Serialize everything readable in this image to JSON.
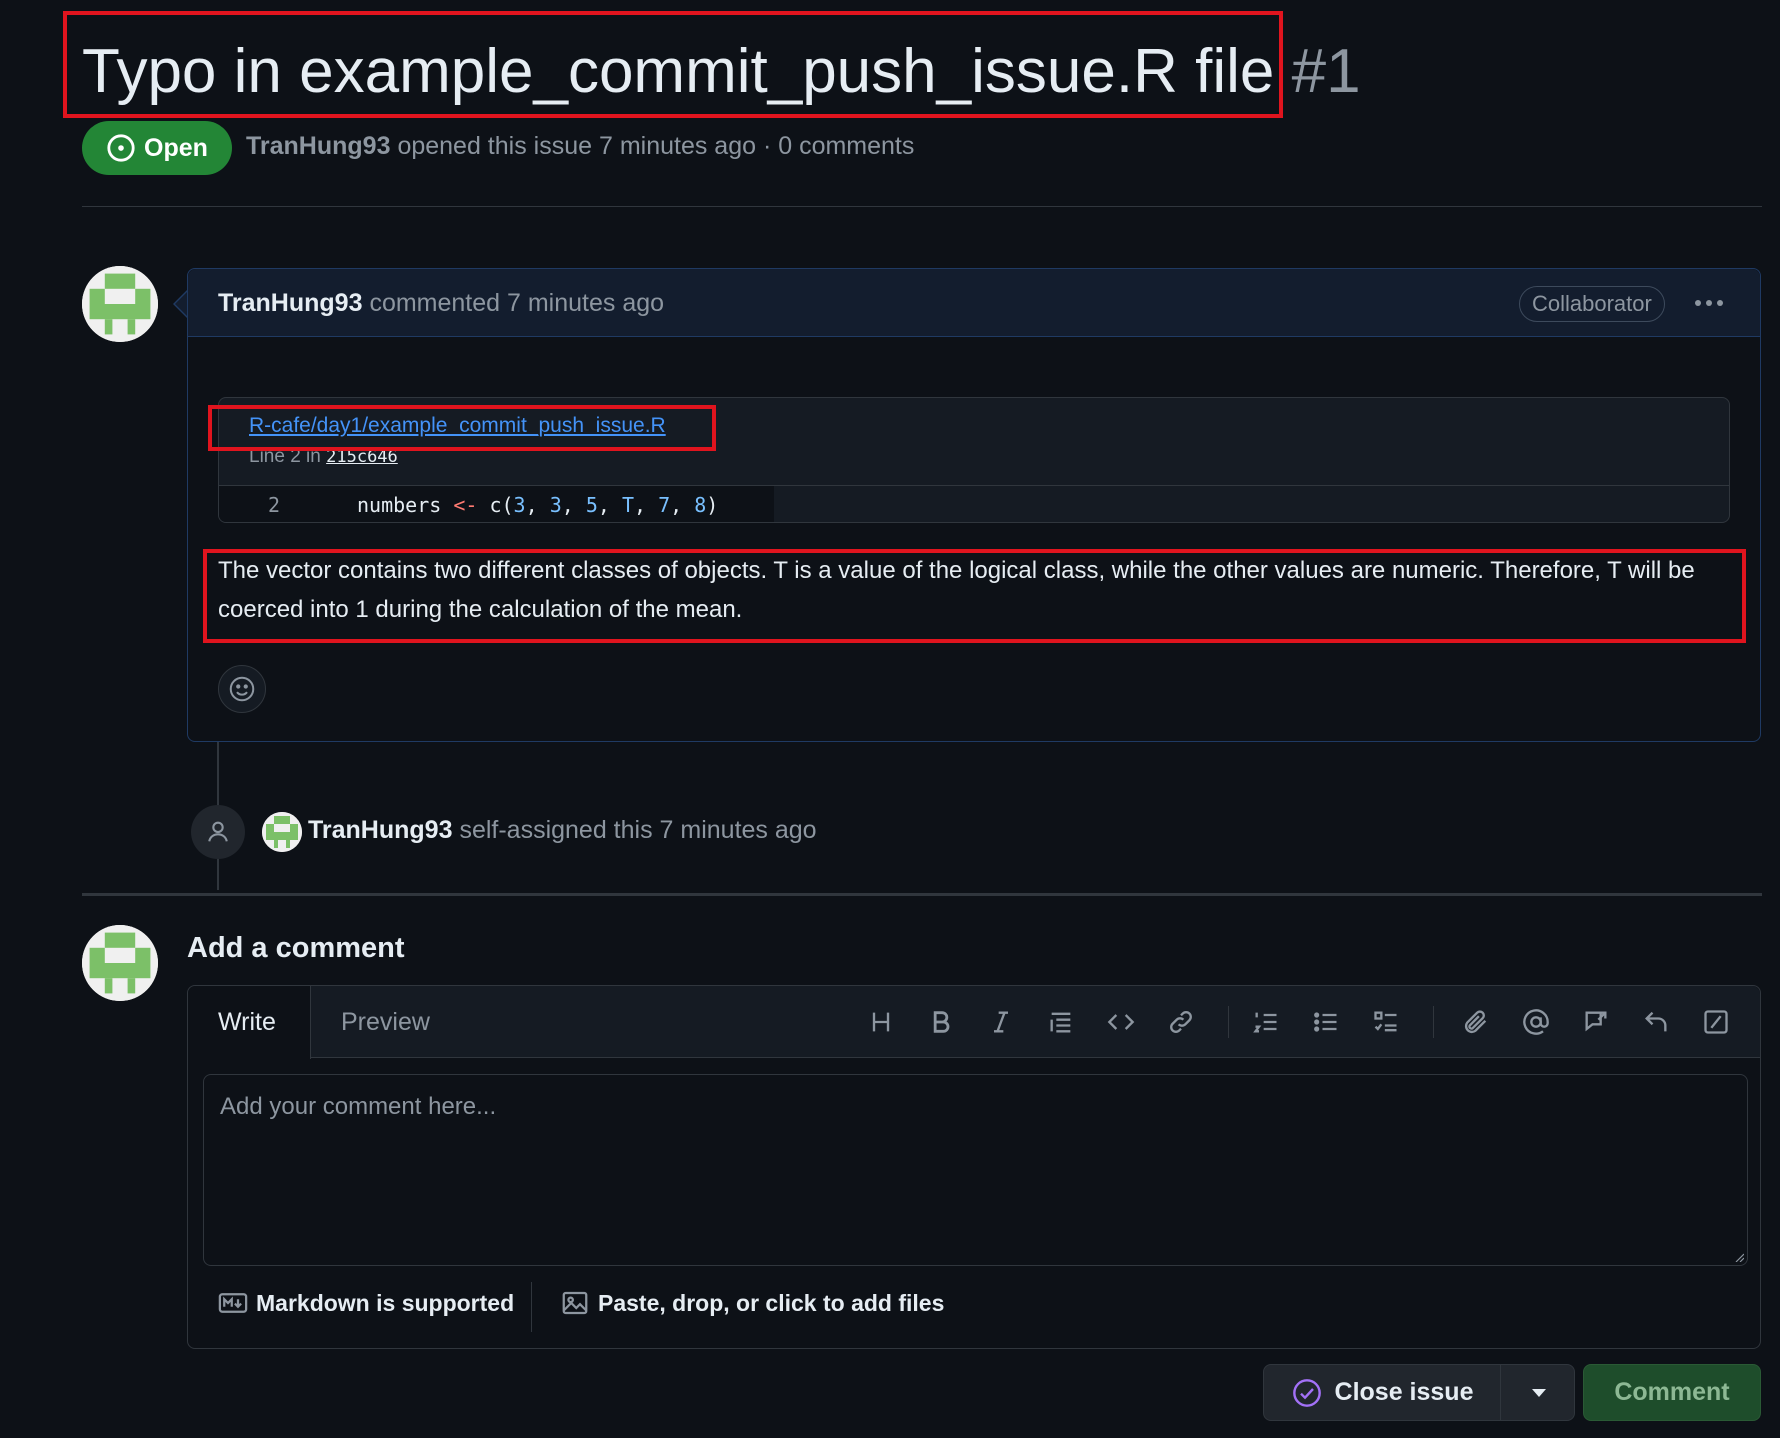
{
  "issue": {
    "title": "Typo in example_commit_push_issue.R file",
    "number": "#1",
    "state": "Open",
    "author": "TranHung93",
    "meta_text": "opened this issue 7 minutes ago · 0 comments"
  },
  "comment": {
    "author": "TranHung93",
    "meta_text": "commented 7 minutes ago",
    "role": "Collaborator",
    "snippet": {
      "file_path": "R-cafe/day1/example_commit_push_issue.R",
      "line_prefix": "Line 2 in",
      "commit_sha": "215c646",
      "line_number": "2",
      "code_tokens": {
        "var": "numbers ",
        "assign": "<-",
        "call": " c(",
        "n1": "3",
        "s1": ", ",
        "n2": "3",
        "s2": ", ",
        "n3": "5",
        "s3": ", ",
        "t": "T",
        "s4": ", ",
        "n4": "7",
        "s5": ", ",
        "n5": "8",
        "close": ")"
      }
    },
    "body": "The vector contains two different classes of objects. T is a value of the logical class, while the other values are numeric. Therefore, T will be coerced into 1 during the calculation of the mean."
  },
  "timeline_event": {
    "author": "TranHung93",
    "text": "self-assigned this 7 minutes ago"
  },
  "add_comment": {
    "title": "Add a comment",
    "tab_write": "Write",
    "tab_preview": "Preview",
    "placeholder": "Add your comment here...",
    "markdown_note": "Markdown is supported",
    "files_note": "Paste, drop, or click to add files",
    "toolbar_icons": [
      "heading-icon",
      "bold-icon",
      "italic-icon",
      "quote-icon",
      "code-icon",
      "link-icon",
      "ordered-list-icon",
      "unordered-list-icon",
      "task-list-icon",
      "attach-icon",
      "mention-icon",
      "reference-icon",
      "reply-icon",
      "slash-command-icon"
    ]
  },
  "actions": {
    "close_issue": "Close issue",
    "comment": "Comment"
  },
  "colors": {
    "background": "#0d1117",
    "open_badge": "#238636",
    "link": "#4493f8",
    "annotation_red": "#e0141e"
  }
}
